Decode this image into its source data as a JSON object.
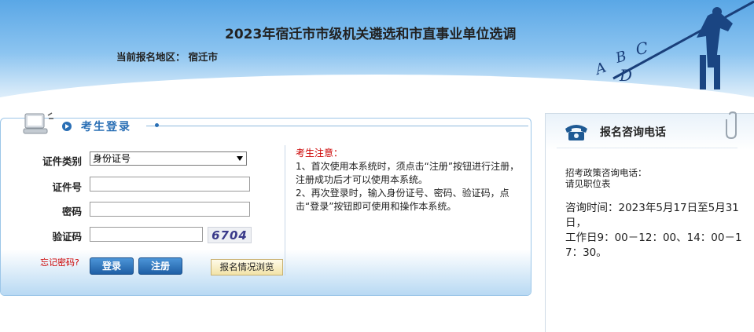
{
  "header": {
    "title": "2023年宿迁市市级机关遴选和市直事业单位选调",
    "region_label": "当前报名地区：",
    "region_value": "宿迁市",
    "art_letters": [
      "A",
      "B",
      "C",
      "D"
    ]
  },
  "login": {
    "title": "考生登录",
    "fields": {
      "id_type_label": "证件类别",
      "id_type_value": "身份证号",
      "id_number_label": "证件号",
      "id_number_value": "",
      "password_label": "密码",
      "password_value": "",
      "captcha_label": "验证码",
      "captcha_value": "",
      "captcha_image_text": "6704"
    },
    "forgot_password": "忘记密码?",
    "login_button": "登录",
    "register_button": "注册",
    "browse_button": "报名情况浏览"
  },
  "notice": {
    "title": "考生注意：",
    "line1": "1、首次使用本系统时，须点击“注册”按钮进行注册，注册成功后才可以使用本系统。",
    "line2": "2、再次登录时，输入身份证号、密码、验证码，点击“登录”按钮即可使用和操作本系统。"
  },
  "consult": {
    "title": "报名咨询电话",
    "sub_line1": "招考政策咨询电话：",
    "sub_line2": "请见职位表",
    "time_text": "咨询时间：2023年5月17日至5月31日，",
    "hours_text": "工作日9：00－12：00、14：00－17：30。"
  },
  "colors": {
    "accent_blue": "#2a6fb5",
    "notice_red": "#cc0000",
    "header_sky": "#5aa7e6"
  }
}
